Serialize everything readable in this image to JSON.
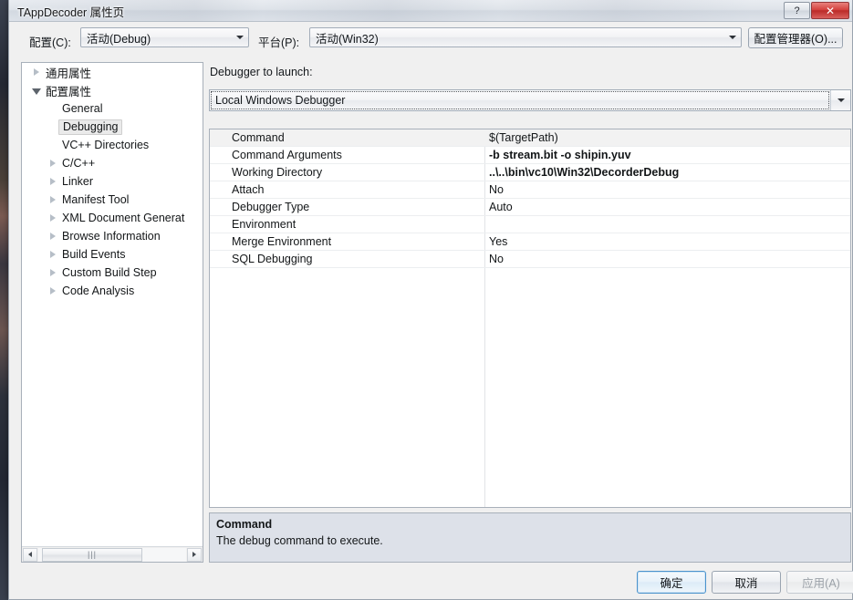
{
  "window": {
    "title": "TAppDecoder 属性页",
    "help_button": "?",
    "close_button": "✕"
  },
  "config_bar": {
    "configuration_label": "配置(C):",
    "configuration_value": "活动(Debug)",
    "platform_label": "平台(P):",
    "platform_value": "活动(Win32)",
    "config_manager_button": "配置管理器(O)..."
  },
  "tree": {
    "items": [
      {
        "label": "通用属性",
        "indent": 0,
        "state": "collapsed",
        "selected": false
      },
      {
        "label": "配置属性",
        "indent": 0,
        "state": "expanded",
        "selected": false
      },
      {
        "label": "General",
        "indent": 1,
        "state": "leaf",
        "selected": false
      },
      {
        "label": "Debugging",
        "indent": 1,
        "state": "leaf",
        "selected": true
      },
      {
        "label": "VC++ Directories",
        "indent": 1,
        "state": "leaf",
        "selected": false
      },
      {
        "label": "C/C++",
        "indent": 1,
        "state": "collapsed",
        "selected": false
      },
      {
        "label": "Linker",
        "indent": 1,
        "state": "collapsed",
        "selected": false
      },
      {
        "label": "Manifest Tool",
        "indent": 1,
        "state": "collapsed",
        "selected": false
      },
      {
        "label": "XML Document Generat",
        "indent": 1,
        "state": "collapsed",
        "selected": false
      },
      {
        "label": "Browse Information",
        "indent": 1,
        "state": "collapsed",
        "selected": false
      },
      {
        "label": "Build Events",
        "indent": 1,
        "state": "collapsed",
        "selected": false
      },
      {
        "label": "Custom Build Step",
        "indent": 1,
        "state": "collapsed",
        "selected": false
      },
      {
        "label": "Code Analysis",
        "indent": 1,
        "state": "collapsed",
        "selected": false
      }
    ],
    "scrollbar": {
      "left_arrow": "◄",
      "right_arrow": "►",
      "thumb_grip": "|||"
    }
  },
  "main": {
    "debugger_label": "Debugger to launch:",
    "debugger_value": "Local Windows Debugger",
    "properties": [
      {
        "name": "Command",
        "value": "$(TargetPath)",
        "bold": false,
        "selected": true
      },
      {
        "name": "Command Arguments",
        "value": "-b stream.bit -o shipin.yuv",
        "bold": true,
        "selected": false
      },
      {
        "name": "Working Directory",
        "value": "..\\..\\bin\\vc10\\Win32\\DecorderDebug",
        "bold": true,
        "selected": false
      },
      {
        "name": "Attach",
        "value": "No",
        "bold": false,
        "selected": false
      },
      {
        "name": "Debugger Type",
        "value": "Auto",
        "bold": false,
        "selected": false
      },
      {
        "name": "Environment",
        "value": "",
        "bold": false,
        "selected": false
      },
      {
        "name": "Merge Environment",
        "value": "Yes",
        "bold": false,
        "selected": false
      },
      {
        "name": "SQL Debugging",
        "value": "No",
        "bold": false,
        "selected": false
      }
    ]
  },
  "description": {
    "title": "Command",
    "body": "The debug command to execute."
  },
  "footer": {
    "ok_button": "确定",
    "cancel_button": "取消",
    "apply_button": "应用(A)"
  },
  "colors": {
    "close_red": "#d4423f",
    "default_button_border": "#4b93cc",
    "description_bg": "#dde1e9"
  }
}
